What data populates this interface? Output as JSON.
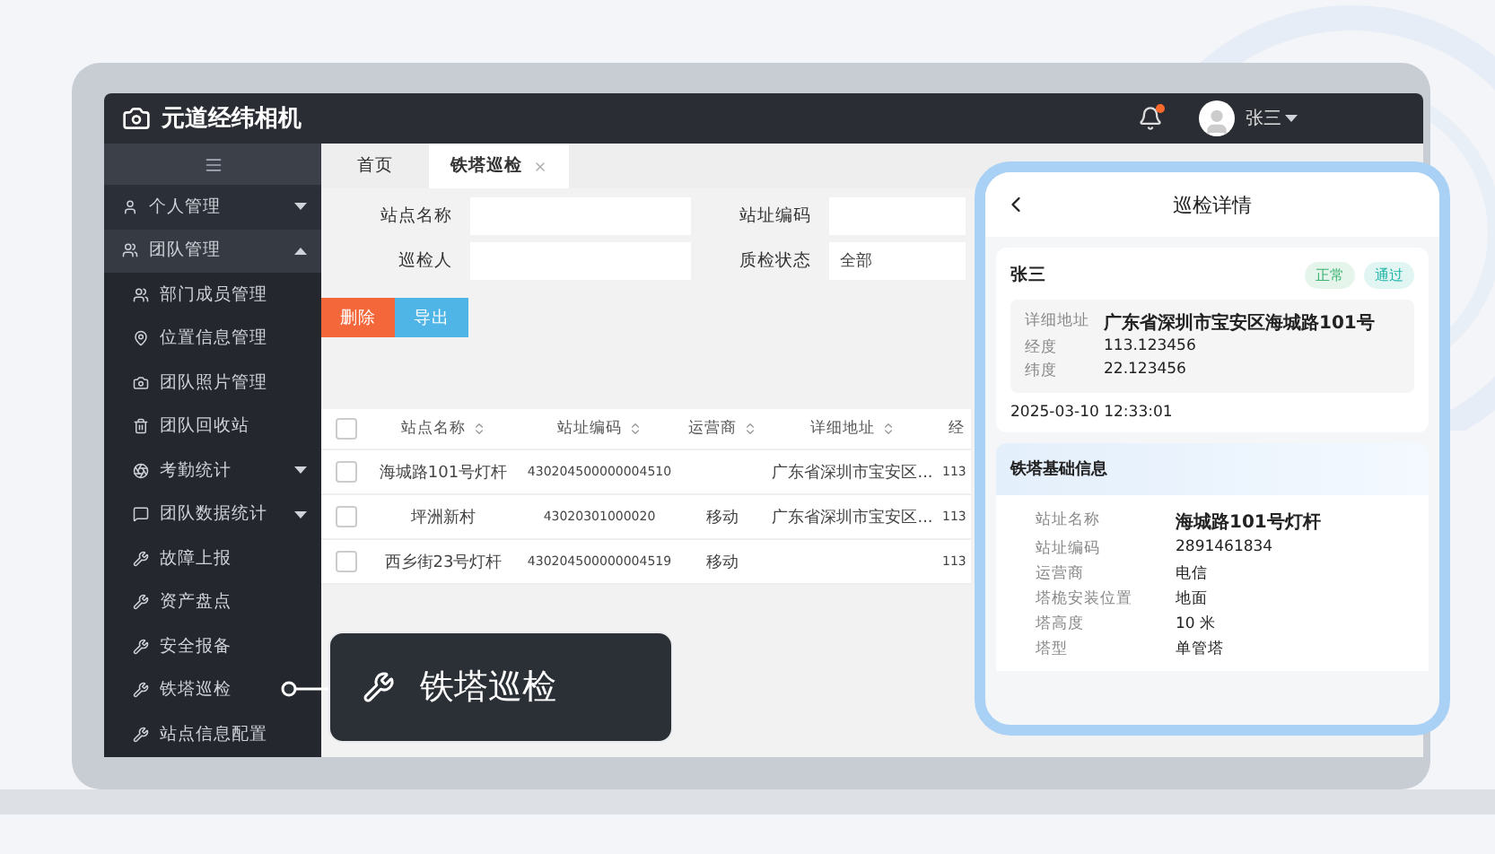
{
  "app": {
    "title": "元道经纬相机"
  },
  "user": {
    "name": "张三",
    "has_notification": true
  },
  "sidebar": {
    "items": [
      {
        "label": "个人管理",
        "kind": "group",
        "expanded": false
      },
      {
        "label": "团队管理",
        "kind": "group",
        "expanded": true,
        "children": [
          {
            "label": "部门成员管理",
            "kind": "link"
          },
          {
            "label": "位置信息管理",
            "kind": "link"
          },
          {
            "label": "团队照片管理",
            "kind": "link"
          },
          {
            "label": "团队回收站",
            "kind": "link"
          },
          {
            "label": "考勤统计",
            "kind": "group",
            "expanded": false
          },
          {
            "label": "团队数据统计",
            "kind": "group",
            "expanded": false
          },
          {
            "label": "故障上报",
            "kind": "link"
          },
          {
            "label": "资产盘点",
            "kind": "link"
          },
          {
            "label": "安全报备",
            "kind": "link"
          },
          {
            "label": "铁塔巡检",
            "kind": "link"
          },
          {
            "label": "站点信息配置",
            "kind": "link"
          }
        ]
      }
    ]
  },
  "tabs": [
    {
      "label": "首页",
      "selected": false,
      "closable": false
    },
    {
      "label": "铁塔巡检",
      "selected": true,
      "closable": true
    }
  ],
  "filters": [
    {
      "label": "站点名称"
    },
    {
      "label": "站址编码"
    },
    {
      "label": "巡检人"
    },
    {
      "label": "质检状态",
      "value": "全部"
    }
  ],
  "actions": [
    {
      "label": "删除",
      "kind": "danger"
    },
    {
      "label": "导出",
      "kind": "primary"
    }
  ],
  "table": {
    "all_checked": false,
    "columns": [
      {
        "label": "站点名称",
        "sortable": true
      },
      {
        "label": "站址编码",
        "sortable": true
      },
      {
        "label": "运营商",
        "sortable": true
      },
      {
        "label": "详细地址",
        "sortable": true
      },
      {
        "label": "经",
        "sortable": false
      }
    ],
    "rows": [
      {
        "checked": false,
        "site_name": "海城路101号灯杆",
        "site_code": "430204500000004510",
        "address": "广东省深圳市宝安区...",
        "column_5": "113"
      },
      {
        "checked": false,
        "site_name": "坪洲新村",
        "site_code": "43020301000020",
        "operator": "移动",
        "address": "广东省深圳市宝安区...",
        "column_5": "113"
      },
      {
        "checked": false,
        "site_name": "西乡街23号灯杆",
        "site_code": "430204500000004519",
        "operator": "移动",
        "column_5": "113"
      }
    ]
  },
  "callout": {
    "label": "铁塔巡检"
  },
  "phone": {
    "title": "巡检详情",
    "record": {
      "name": "张三",
      "tags": [
        {
          "label": "正常",
          "color": "#3cb371"
        },
        {
          "label": "通过",
          "color": "#1fb5a8"
        }
      ],
      "fields": [
        {
          "label": "详细地址",
          "value": "广东省深圳市宝安区海城路101号"
        },
        {
          "label": "经度",
          "value": "113.123456"
        },
        {
          "label": "纬度",
          "value": "22.123456"
        }
      ],
      "time": "2025-03-10 12:33:01"
    },
    "section": {
      "title": "铁塔基础信息",
      "fields": [
        {
          "label": "站址名称",
          "value": "海城路101号灯杆"
        },
        {
          "label": "站址编码",
          "value": "2891461834"
        },
        {
          "label": "运营商",
          "value": "电信"
        },
        {
          "label": "塔桅安装位置",
          "value": "地面"
        },
        {
          "label": "塔高度",
          "value": "10 米"
        },
        {
          "label": "塔型",
          "value": "单管塔"
        }
      ]
    }
  }
}
